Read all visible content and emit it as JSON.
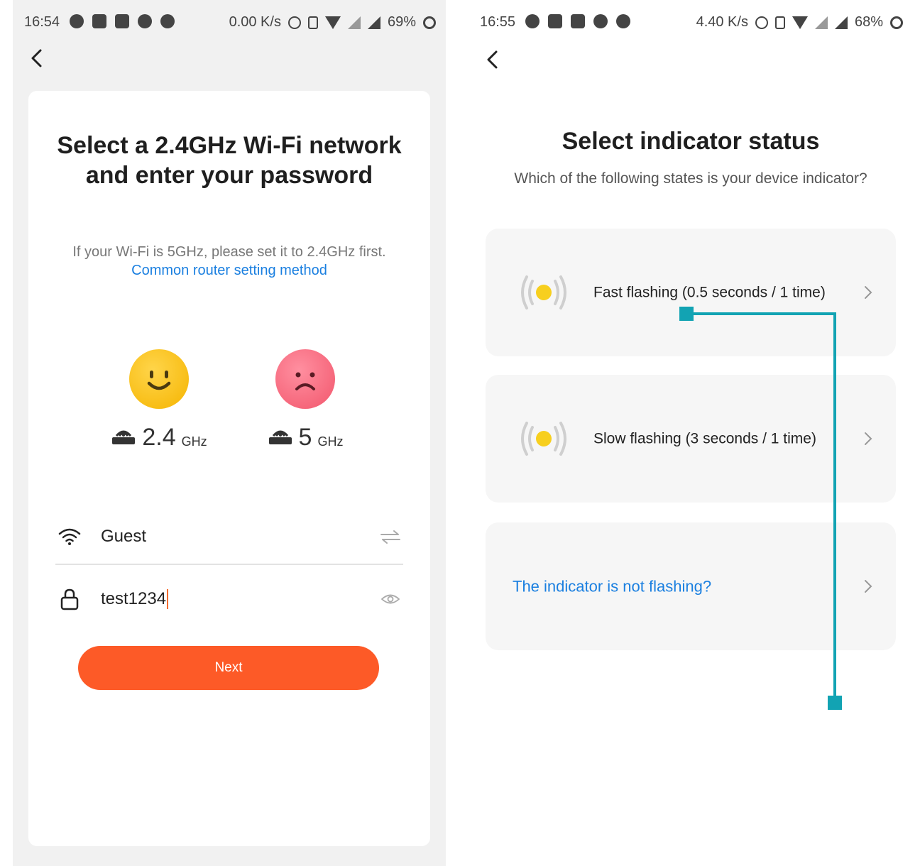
{
  "left_screen": {
    "statusbar": {
      "time": "16:54",
      "net_speed": "0.00 K/s",
      "battery": "69%"
    },
    "title": "Select a 2.4GHz Wi-Fi network and enter your password",
    "hint_text": "If your Wi-Fi is 5GHz, please set it to 2.4GHz first.",
    "hint_link": "Common router setting method",
    "bands": [
      {
        "num": "2.4",
        "unit": "GHz",
        "status": "supported"
      },
      {
        "num": "5",
        "unit": "GHz",
        "status": "unsupported"
      }
    ],
    "ssid": {
      "value": "Guest",
      "lead_icon": "wifi-icon",
      "trail_icon": "switch-network-icon"
    },
    "password": {
      "value": "test1234",
      "lead_icon": "lock-icon",
      "trail_icon": "eye-icon"
    },
    "next_label": "Next",
    "accent": "#fd5a27",
    "link_color": "#1a7fe0"
  },
  "right_screen": {
    "statusbar": {
      "time": "16:55",
      "net_speed": "4.40 K/s",
      "battery": "68%"
    },
    "title": "Select indicator status",
    "subtitle": "Which of the following states is your device indicator?",
    "options": [
      {
        "label": "Fast flashing (0.5 seconds / 1 time)",
        "icon": "indicator-light-icon"
      },
      {
        "label": "Slow flashing (3 seconds / 1 time)",
        "icon": "indicator-light-icon"
      },
      {
        "label": "The indicator is not flashing?",
        "icon": ""
      }
    ],
    "indicator_color": "#f7cf1e",
    "annotation_color": "#12a3b3"
  }
}
